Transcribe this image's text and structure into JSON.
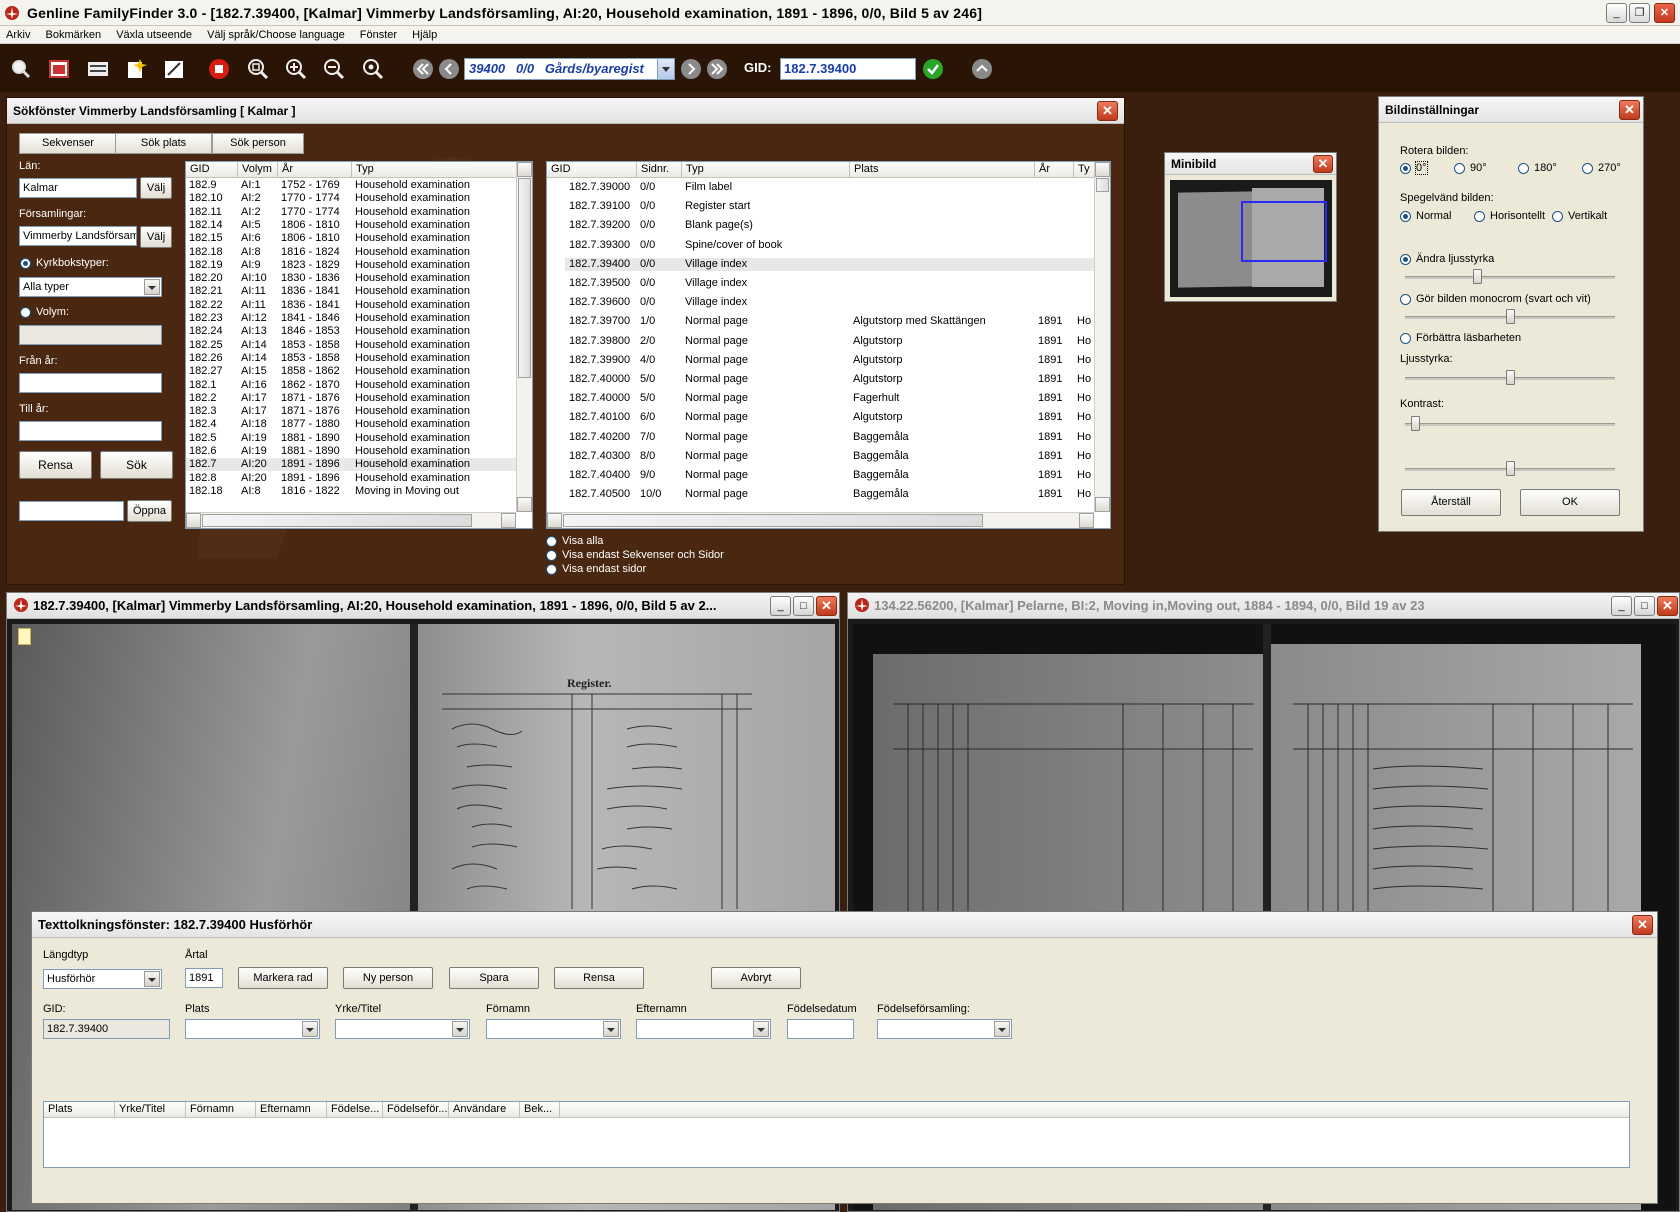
{
  "app": {
    "title": "Genline FamilyFinder 3.0 - [182.7.39400, [Kalmar] Vimmerby Landsförsamling, AI:20, Household examination, 1891 - 1896, 0/0, Bild 5 av 246]",
    "menu": [
      "Arkiv",
      "Bokmärken",
      "Växla utseende",
      "Välj språk/Choose language",
      "Fönster",
      "Hjälp"
    ]
  },
  "toolbar": {
    "sequence_value": "39400   0/0   Gårds/byaregist",
    "gid_label": "GID:",
    "gid_value": "182.7.39400"
  },
  "search": {
    "title": "Sökfönster    Vimmerby Landsförsamling  [ Kalmar ]",
    "tabs": [
      "Sekvenser",
      "Sök plats",
      "Sök person"
    ],
    "lan_label": "Län:",
    "lan_value": "Kalmar",
    "valj": "Välj",
    "forsamlingar_label": "Församlingar:",
    "forsamling_value": "Vimmerby Landsförsaml",
    "kyrkbokstyper_label": "Kyrkbokstyper:",
    "typ_value": "Alla typer",
    "volym_label": "Volym:",
    "fran_label": "Från år:",
    "till_label": "Till år:",
    "rensa": "Rensa",
    "sok": "Sök",
    "oppna": "Öppna",
    "vol_columns": [
      "GID",
      "Volym",
      "År",
      "Typ"
    ],
    "volumes": [
      [
        "182.9",
        "AI:1",
        "1752 - 1769",
        "Household examination"
      ],
      [
        "182.10",
        "AI:2",
        "1770 - 1774",
        "Household examination"
      ],
      [
        "182.11",
        "AI:2",
        "1770 - 1774",
        "Household examination"
      ],
      [
        "182.14",
        "AI:5",
        "1806 - 1810",
        "Household examination"
      ],
      [
        "182.15",
        "AI:6",
        "1806 - 1810",
        "Household examination"
      ],
      [
        "182.18",
        "AI:8",
        "1816 - 1824",
        "Household examination"
      ],
      [
        "182.19",
        "AI:9",
        "1823 - 1829",
        "Household examination"
      ],
      [
        "182.20",
        "AI:10",
        "1830 - 1836",
        "Household examination"
      ],
      [
        "182.21",
        "AI:11",
        "1836 - 1841",
        "Household examination"
      ],
      [
        "182.22",
        "AI:11",
        "1836 - 1841",
        "Household examination"
      ],
      [
        "182.23",
        "AI:12",
        "1841 - 1846",
        "Household examination"
      ],
      [
        "182.24",
        "AI:13",
        "1846 - 1853",
        "Household examination"
      ],
      [
        "182.25",
        "AI:14",
        "1853 - 1858",
        "Household examination"
      ],
      [
        "182.26",
        "AI:14",
        "1853 - 1858",
        "Household examination"
      ],
      [
        "182.27",
        "AI:15",
        "1858 - 1862",
        "Household examination"
      ],
      [
        "182.1",
        "AI:16",
        "1862 - 1870",
        "Household examination"
      ],
      [
        "182.2",
        "AI:17",
        "1871 - 1876",
        "Household examination"
      ],
      [
        "182.3",
        "AI:17",
        "1871 - 1876",
        "Household examination"
      ],
      [
        "182.4",
        "AI:18",
        "1877 - 1880",
        "Household examination"
      ],
      [
        "182.5",
        "AI:19",
        "1881 - 1890",
        "Household examination"
      ],
      [
        "182.6",
        "AI:19",
        "1881 - 1890",
        "Household examination"
      ],
      [
        "182.7",
        "AI:20",
        "1891 - 1896",
        "Household examination"
      ],
      [
        "182.8",
        "AI:20",
        "1891 - 1896",
        "Household examination"
      ],
      [
        "182.18",
        "AI:8",
        "1816 - 1822",
        "Moving in Moving out"
      ]
    ],
    "selected_volume": 21,
    "seq_columns": [
      "GID",
      "Sidnr.",
      "Typ",
      "Plats",
      "År",
      "Ty"
    ],
    "sequences": [
      [
        "182.7.39000",
        "0/0",
        "Film label",
        "",
        "",
        ""
      ],
      [
        "182.7.39100",
        "0/0",
        "Register start",
        "",
        "",
        ""
      ],
      [
        "182.7.39200",
        "0/0",
        "Blank page(s)",
        "",
        "",
        ""
      ],
      [
        "182.7.39300",
        "0/0",
        "Spine/cover of book",
        "",
        "",
        ""
      ],
      [
        "182.7.39400",
        "0/0",
        "Village index",
        "",
        "",
        ""
      ],
      [
        "182.7.39500",
        "0/0",
        "Village index",
        "",
        "",
        ""
      ],
      [
        "182.7.39600",
        "0/0",
        "Village index",
        "",
        "",
        ""
      ],
      [
        "182.7.39700",
        "1/0",
        "Normal page",
        "Algutstorp med Skattängen",
        "1891",
        "Ho"
      ],
      [
        "182.7.39800",
        "2/0",
        "Normal page",
        "Algutstorp",
        "1891",
        "Ho"
      ],
      [
        "182.7.39900",
        "4/0",
        "Normal page",
        "Algutstorp",
        "1891",
        "Ho"
      ],
      [
        "182.7.40000",
        "5/0",
        "Normal page",
        "Algutstorp",
        "1891",
        "Ho"
      ],
      [
        "182.7.40000",
        "5/0",
        "Normal page",
        "Fagerhult",
        "1891",
        "Ho"
      ],
      [
        "182.7.40100",
        "6/0",
        "Normal page",
        "Algutstorp",
        "1891",
        "Ho"
      ],
      [
        "182.7.40200",
        "7/0",
        "Normal page",
        "Baggemåla",
        "1891",
        "Ho"
      ],
      [
        "182.7.40300",
        "8/0",
        "Normal page",
        "Baggemåla",
        "1891",
        "Ho"
      ],
      [
        "182.7.40400",
        "9/0",
        "Normal page",
        "Baggemåla",
        "1891",
        "Ho"
      ],
      [
        "182.7.40500",
        "10/0",
        "Normal page",
        "Baggemåla",
        "1891",
        "Ho"
      ]
    ],
    "selected_sequence": 4,
    "show_options": [
      "Visa alla",
      "Visa endast Sekvenser och Sidor",
      "Visa endast sidor"
    ]
  },
  "minibild": {
    "title": "Minibild"
  },
  "settings": {
    "title": "Bildinställningar",
    "rotate_label": "Rotera bilden:",
    "rotate_options": [
      "0°",
      "90°",
      "180°",
      "270°"
    ],
    "mirror_label": "Spegelvänd bilden:",
    "mirror_options": [
      "Normal",
      "Horisontellt",
      "Vertikalt"
    ],
    "option_brightness": "Ändra ljusstyrka",
    "option_mono": "Gör bilden monocrom (svart och vit)",
    "option_readability": "Förbättra läsbarheten",
    "ljusstyrka_label": "Ljusstyrka:",
    "kontrast_label": "Kontrast:",
    "reset": "Återställ",
    "ok": "OK"
  },
  "viewer1": {
    "title": "182.7.39400,  [Kalmar]  Vimmerby Landsförsamling,  AI:20, Household examination, 1891 - 1896, 0/0,  Bild 5 av 2...",
    "heading": "Register."
  },
  "viewer2": {
    "title": "134.22.56200,  [Kalmar]  Pelarne,  BI:2, Moving in,Moving out, 1884 - 1894, 0/0,  Bild 19 av 23"
  },
  "transcribe": {
    "title": "Texttolkningsfönster: 182.7.39400     Husförhör",
    "langdtyp_label": "Längdtyp",
    "langdtyp_value": "Husförhör",
    "artal_label": "Årtal",
    "artal_value": "1891",
    "buttons": [
      "Markera rad",
      "Ny person",
      "Spara",
      "Rensa",
      "Avbryt"
    ],
    "gid_label": "GID:",
    "gid_value": "182.7.39400",
    "fields": [
      "Plats",
      "Yrke/Titel",
      "Förnamn",
      "Efternamn",
      "Födelsedatum",
      "Födelseförsamling:"
    ],
    "columns": [
      "Plats",
      "Yrke/Titel",
      "Förnamn",
      "Efternamn",
      "Födelse...",
      "Födelseför...",
      "Användare",
      "Bek..."
    ]
  }
}
